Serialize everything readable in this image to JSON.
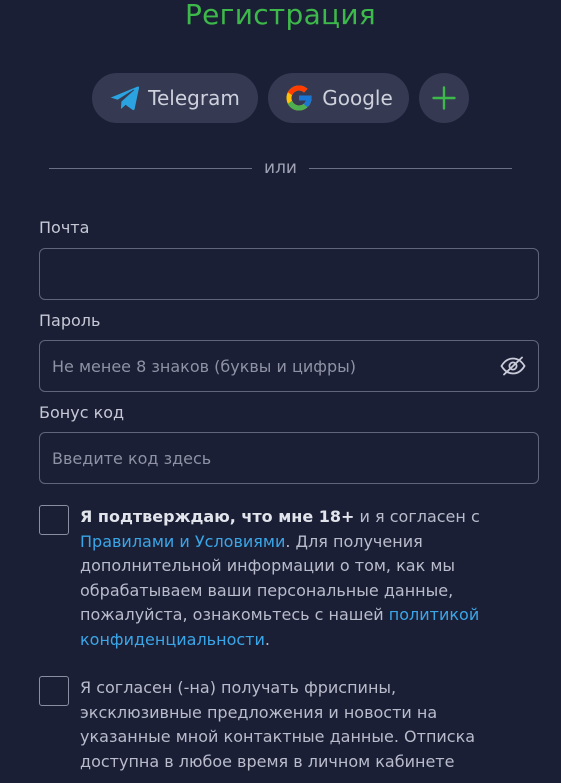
{
  "page": {
    "title": "Регистрация"
  },
  "social": {
    "telegram_label": "Telegram",
    "google_label": "Google",
    "more_icon": "plus-icon"
  },
  "divider": {
    "text": "или"
  },
  "form": {
    "email": {
      "label": "Почта",
      "value": "",
      "placeholder": ""
    },
    "password": {
      "label": "Пароль",
      "value": "",
      "placeholder": "Не менее 8 знаков (буквы и цифры)",
      "toggle_icon": "eye-off-icon"
    },
    "bonus": {
      "label": "Бонус код",
      "value": "",
      "placeholder": "Введите код здесь"
    }
  },
  "agreements": {
    "age": {
      "bold": "Я подтверждаю, что мне 18+",
      "text_1": " и я согласен с ",
      "rules_link": "Правилами и Условиями",
      "text_2": ". Для получения дополнительной информации о том, как мы обрабатываем ваши персональные данные, пожалуйста, ознакомьтесь с нашей ",
      "privacy_link": "политикой конфиденциальности",
      "text_3": "."
    },
    "marketing": {
      "text": "Я согласен (-на) получать фриспины, эксклюзивные предложения и новости на указанные мной контактные данные. Отписка доступна в любое время в личном кабинете"
    }
  },
  "colors": {
    "background": "#1b1f36",
    "accent_green": "#3db84a",
    "link_blue": "#3aa6e8",
    "button_bg": "#353a52"
  }
}
